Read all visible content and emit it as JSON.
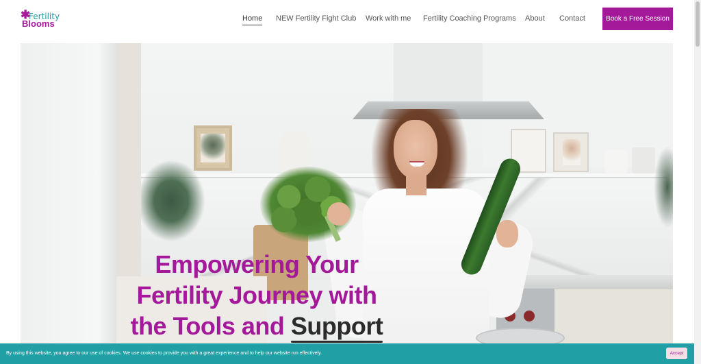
{
  "logo": {
    "line1": "Fertility",
    "line2": "Blooms",
    "flower_icon": "✱"
  },
  "nav": {
    "items": [
      {
        "label": "Home",
        "active": true
      },
      {
        "label": "NEW Fertility Fight Club",
        "active": false
      },
      {
        "label": "Work with me",
        "active": false
      },
      {
        "label": "Fertility Coaching Programs",
        "active": false
      },
      {
        "label": "About",
        "active": false
      },
      {
        "label": "Contact",
        "active": false
      }
    ],
    "cta_label": "Book a Free Session"
  },
  "hero": {
    "headline_line1": "Empowering Your",
    "headline_line2": "Fertility Journey with",
    "headline_line3_a": "the Tools and ",
    "headline_line3_b": "Support"
  },
  "cookie_bar": {
    "text": "By using this website, you agree to our use of cookies. We use cookies to provide you with a great experience and to help our website run effectively.",
    "accept_label": "Accept"
  },
  "colors": {
    "brand_magenta": "#a3199a",
    "brand_teal": "#20a0a5",
    "accept_bg": "#f3dde6"
  }
}
